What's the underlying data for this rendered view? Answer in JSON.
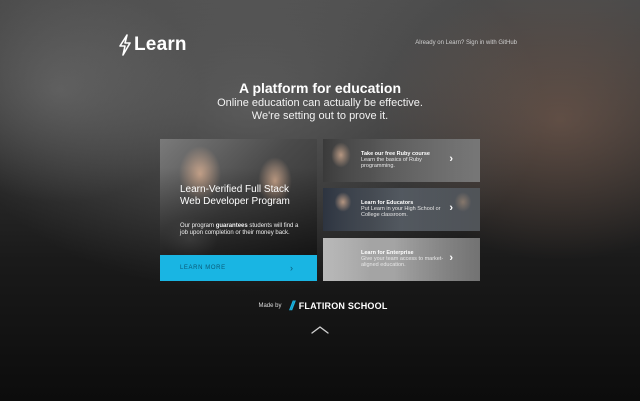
{
  "header": {
    "logo_text": "Learn",
    "signin_link": "Already on Learn? Sign in with GitHub"
  },
  "hero": {
    "title": "A platform for education",
    "subtitle_line1": "Online education can actually be effective.",
    "subtitle_line2": "We're setting out to prove it."
  },
  "feature": {
    "title": "Learn-Verified Full Stack Web Developer Program",
    "desc_before": "Our program ",
    "desc_bold": "guarantees",
    "desc_after": " students will find a job upon completion or their money back.",
    "button_label": "LEARN MORE",
    "button_arrow": "›"
  },
  "cards": [
    {
      "title": "Take our free Ruby course",
      "desc": "Learn the basics of Ruby programming.",
      "chevron": "›"
    },
    {
      "title": "Learn for Educators",
      "desc": "Put Learn in your High School or College classroom.",
      "chevron": "›"
    },
    {
      "title": "Learn for Enterprise",
      "desc": "Give your team access to market-aligned education.",
      "chevron": "›"
    }
  ],
  "footer": {
    "made_by": "Made by",
    "brand_mark": "//",
    "brand_name": "FLATIRON SCHOOL"
  },
  "colors": {
    "accent": "#19b5e3",
    "background": "#1a1a1a"
  },
  "icons": {
    "logo": "lightning-bolt-icon",
    "scroll": "chevron-up-icon"
  }
}
